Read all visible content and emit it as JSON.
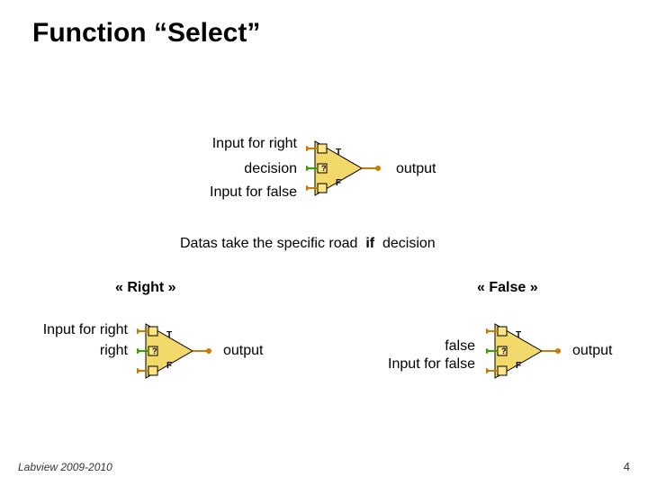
{
  "title": "Function “Select”",
  "top": {
    "in_right": "Input for right",
    "decision": "decision",
    "in_false": "Input for false",
    "output": "output"
  },
  "middle": {
    "datas1": "Datas take the specific road",
    "datas2": "if",
    "datas3": "decision"
  },
  "left": {
    "heading": "« Right »",
    "l1": "Input for right",
    "l2": "right",
    "out": "output"
  },
  "right": {
    "heading": "« False »",
    "l1": "false",
    "l2": "Input for false",
    "out": "output"
  },
  "footer": {
    "left": "Labview 2009-2010",
    "right": "4"
  }
}
